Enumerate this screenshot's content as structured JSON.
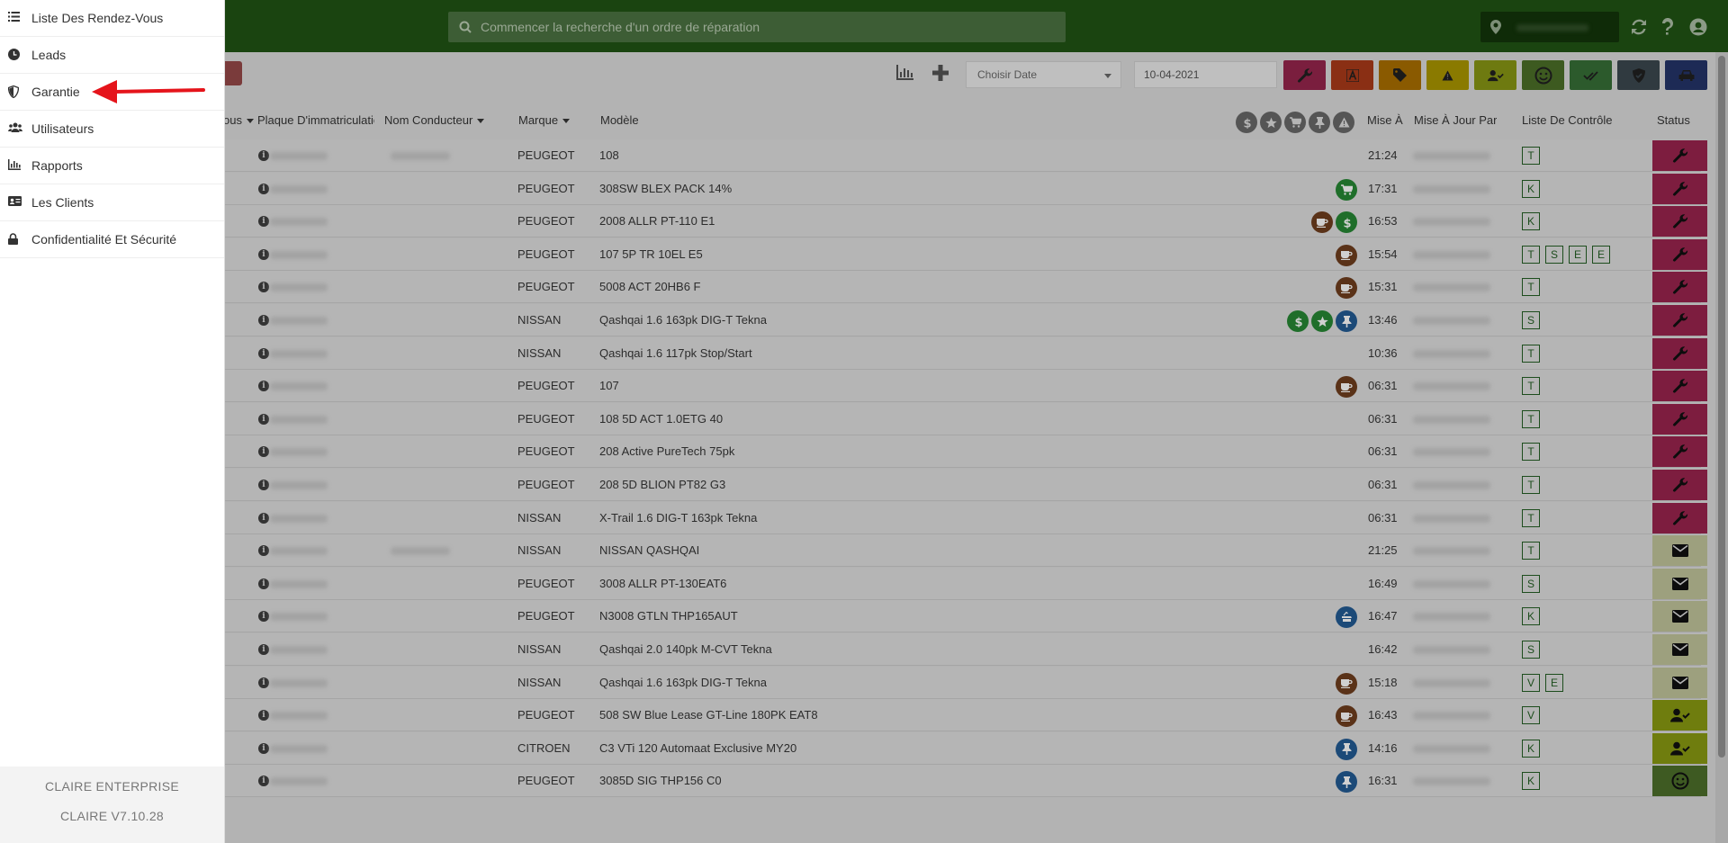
{
  "search": {
    "placeholder": "Commencer la recherche d'un ordre de réparation"
  },
  "toolbar": {
    "date_select": "Choisir Date",
    "date_value": "10-04-2021",
    "filter_buttons": [
      {
        "name": "wrench",
        "color": "#7a1e3e"
      },
      {
        "name": "font",
        "color": "#8a2f14"
      },
      {
        "name": "tag",
        "color": "#8a5a00"
      },
      {
        "name": "warning",
        "color": "#8a7a00"
      },
      {
        "name": "user-check",
        "color": "#6e7a10"
      },
      {
        "name": "smile",
        "color": "#3d5a20"
      },
      {
        "name": "double-check",
        "color": "#2c5a2c"
      },
      {
        "name": "shield",
        "color": "#303a40"
      },
      {
        "name": "car",
        "color": "#1d2a55"
      }
    ]
  },
  "table": {
    "headers": {
      "col_ous": "ous",
      "plate": "Plaque D'immatriculatio",
      "driver": "Nom Conducteur",
      "brand": "Marque",
      "model": "Modèle",
      "mise": "Mise À",
      "updated_by": "Mise À Jour Par",
      "checklist": "Liste De Contrôle",
      "status": "Status"
    },
    "header_icons": [
      "dollar",
      "star",
      "cart",
      "pin",
      "warning"
    ],
    "rows": [
      {
        "brand": "PEUGEOT",
        "model": "108",
        "time": "21:24",
        "icons": [],
        "checks": [
          "T"
        ],
        "status": "wrench"
      },
      {
        "brand": "PEUGEOT",
        "model": "308SW BLEX PACK 14%",
        "time": "17:31",
        "icons": [
          "cart"
        ],
        "checks": [
          "K"
        ],
        "status": "wrench"
      },
      {
        "brand": "PEUGEOT",
        "model": "2008 ALLR PT-110 E1",
        "time": "16:53",
        "icons": [
          "coffee",
          "dollar"
        ],
        "checks": [
          "K"
        ],
        "status": "wrench"
      },
      {
        "brand": "PEUGEOT",
        "model": "107 5P TR 10EL E5",
        "time": "15:54",
        "icons": [
          "coffee"
        ],
        "checks": [
          "T",
          "S",
          "E",
          "E"
        ],
        "status": "wrench"
      },
      {
        "brand": "PEUGEOT",
        "model": "5008 ACT 20HB6 F",
        "time": "15:31",
        "icons": [
          "coffee"
        ],
        "checks": [
          "T"
        ],
        "status": "wrench"
      },
      {
        "brand": "NISSAN",
        "model": "Qashqai 1.6 163pk DIG-T Tekna",
        "time": "13:46",
        "icons": [
          "dollar",
          "star",
          "pin"
        ],
        "checks": [
          "S"
        ],
        "status": "wrench"
      },
      {
        "brand": "NISSAN",
        "model": "Qashqai 1.6 117pk Stop/Start",
        "time": "10:36",
        "icons": [],
        "checks": [
          "T"
        ],
        "status": "wrench"
      },
      {
        "brand": "PEUGEOT",
        "model": "107",
        "time": "06:31",
        "icons": [
          "coffee"
        ],
        "checks": [
          "T"
        ],
        "status": "wrench"
      },
      {
        "brand": "PEUGEOT",
        "model": "108 5D ACT 1.0ETG 40",
        "time": "06:31",
        "icons": [],
        "checks": [
          "T"
        ],
        "status": "wrench"
      },
      {
        "brand": "PEUGEOT",
        "model": "208 Active PureTech 75pk",
        "time": "06:31",
        "icons": [],
        "checks": [
          "T"
        ],
        "status": "wrench"
      },
      {
        "brand": "PEUGEOT",
        "model": "208 5D BLION PT82 G3",
        "time": "06:31",
        "icons": [],
        "checks": [
          "T"
        ],
        "status": "wrench"
      },
      {
        "brand": "NISSAN",
        "model": "X-Trail 1.6 DIG-T 163pk Tekna",
        "time": "06:31",
        "icons": [],
        "checks": [
          "T"
        ],
        "status": "wrench"
      },
      {
        "brand": "NISSAN",
        "model": "NISSAN QASHQAI",
        "time": "21:25",
        "icons": [],
        "checks": [
          "T"
        ],
        "status": "mail"
      },
      {
        "brand": "PEUGEOT",
        "model": "3008 ALLR PT-130EAT6",
        "time": "16:49",
        "icons": [],
        "checks": [
          "S"
        ],
        "status": "mail"
      },
      {
        "brand": "PEUGEOT",
        "model": "N3008 GTLN THP165AUT",
        "time": "16:47",
        "icons": [
          "wash"
        ],
        "checks": [
          "K"
        ],
        "status": "mail"
      },
      {
        "brand": "NISSAN",
        "model": "Qashqai 2.0 140pk M-CVT Tekna",
        "time": "16:42",
        "icons": [],
        "checks": [
          "S"
        ],
        "status": "mail"
      },
      {
        "brand": "NISSAN",
        "model": "Qashqai 1.6 163pk DIG-T Tekna",
        "time": "15:18",
        "icons": [
          "coffee"
        ],
        "checks": [
          "V",
          "E"
        ],
        "status": "mail"
      },
      {
        "brand": "PEUGEOT",
        "model": "508 SW Blue Lease GT-Line 180PK EAT8",
        "time": "16:43",
        "icons": [
          "coffee"
        ],
        "checks": [
          "V"
        ],
        "status": "user"
      },
      {
        "brand": "CITROEN",
        "model": "C3 VTi 120 Automaat Exclusive MY20",
        "time": "14:16",
        "icons": [
          "pin"
        ],
        "checks": [
          "K"
        ],
        "status": "user"
      },
      {
        "brand": "PEUGEOT",
        "model": "3085D SIG THP156 C0",
        "time": "16:31",
        "icons": [
          "pin"
        ],
        "checks": [
          "K"
        ],
        "status": "smile"
      }
    ]
  },
  "status_colors": {
    "wrench": "#7d1d3f",
    "mail": "#9da07e",
    "user": "#6f7d0e",
    "smile": "#3e5a22"
  },
  "icon_colors": {
    "cart": "#1f6e2a",
    "dollar": "#1f6e2a",
    "star": "#1f6e2a",
    "coffee": "#5a3218",
    "pin": "#1c4a78",
    "wash": "#1c4a78"
  },
  "sidebar": {
    "items": [
      {
        "label": "Liste Des Rendez-Vous",
        "icon": "list-icon"
      },
      {
        "label": "Leads",
        "icon": "clock-icon"
      },
      {
        "label": "Garantie",
        "icon": "shield-icon"
      },
      {
        "label": "Utilisateurs",
        "icon": "users-icon"
      },
      {
        "label": "Rapports",
        "icon": "bar-chart-icon"
      },
      {
        "label": "Les Clients",
        "icon": "id-card-icon"
      },
      {
        "label": "Confidentialité Et Sécurité",
        "icon": "lock-icon"
      }
    ],
    "footer_line1": "CLAIRE ENTERPRISE",
    "footer_line2": "CLAIRE V7.10.28"
  }
}
